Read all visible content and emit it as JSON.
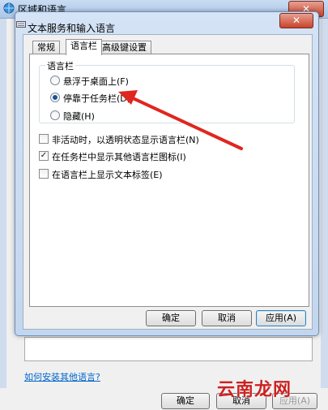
{
  "outer_window": {
    "title": "区域和语言",
    "close_glyph": "✕",
    "install_link": "如何安装其他语言?",
    "buttons": {
      "ok": "确定",
      "cancel": "取消",
      "apply": "应用(A)"
    }
  },
  "dialog": {
    "title": "文本服务和输入语言",
    "close_glyph": "✕",
    "tabs": [
      {
        "label": "常规",
        "active": false
      },
      {
        "label": "语言栏",
        "active": true
      },
      {
        "label": "高级键设置",
        "active": false
      }
    ],
    "group_label": "语言栏",
    "radios": [
      {
        "label": "悬浮于桌面上(F)",
        "checked": false
      },
      {
        "label": "停靠于任务栏(D)",
        "checked": true
      },
      {
        "label": "隐藏(H)",
        "checked": false
      }
    ],
    "checkboxes": [
      {
        "label": "非活动时，以透明状态显示语言栏(N)",
        "checked": false
      },
      {
        "label": "在任务栏中显示其他语言栏图标(I)",
        "checked": true
      },
      {
        "label": "在语言栏上显示文本标签(E)",
        "checked": false
      }
    ],
    "buttons": {
      "ok": "确定",
      "cancel": "取消",
      "apply": "应用(A)"
    }
  },
  "annotation": {
    "arrow_color": "#e0261f"
  },
  "watermark": "云南龙网",
  "colors": {
    "title_bar": "#aac6e8",
    "close_button": "#c7432c",
    "link": "#0066cc"
  }
}
